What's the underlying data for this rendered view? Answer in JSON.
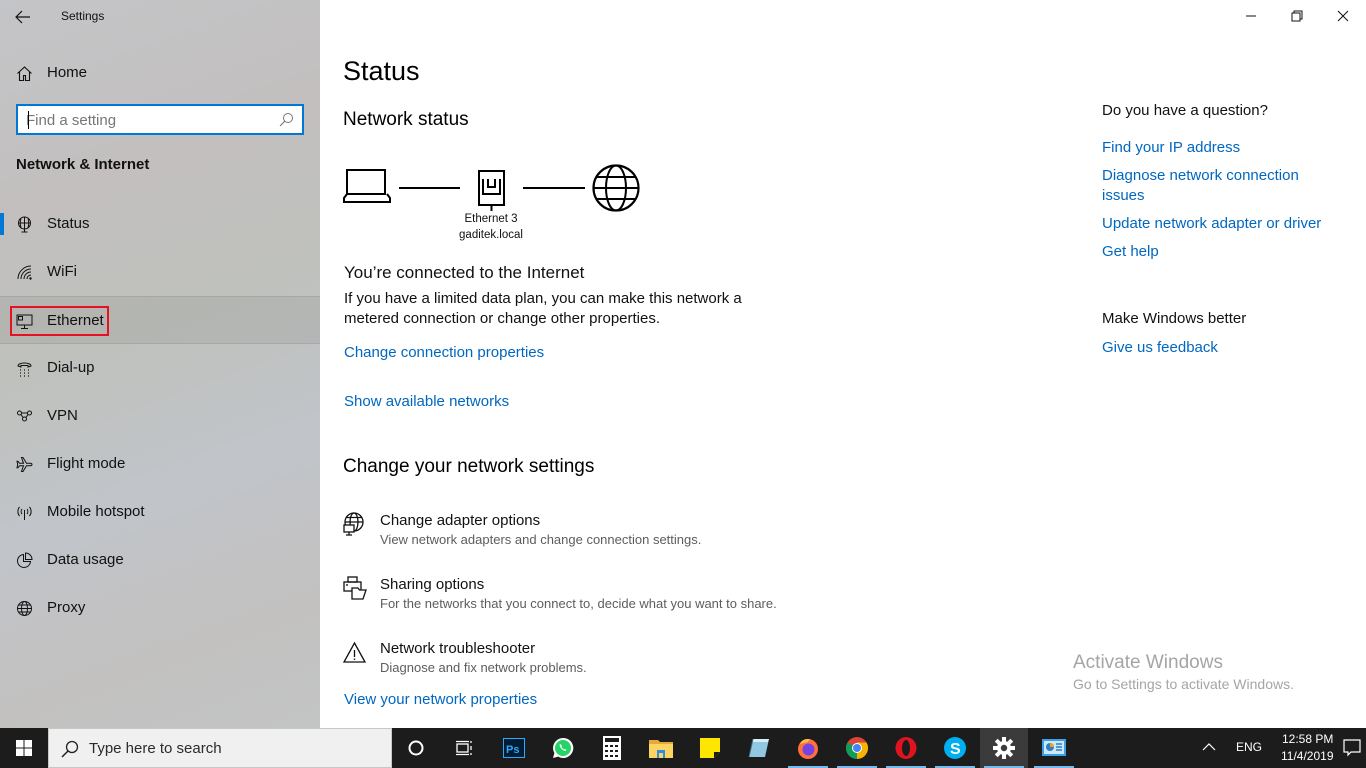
{
  "window": {
    "title": "Settings",
    "controls": {
      "minimize": "minimize-icon",
      "restore": "restore-icon",
      "close": "close-icon"
    }
  },
  "sidebar": {
    "home_label": "Home",
    "search_placeholder": "Find a setting",
    "search_value": "",
    "section_title": "Network & Internet",
    "items": [
      {
        "label": "Status",
        "icon": "network-status-icon",
        "selected": true
      },
      {
        "label": "WiFi",
        "icon": "wifi-icon"
      },
      {
        "label": "Ethernet",
        "icon": "ethernet-icon",
        "hovered": true,
        "highlighted": true
      },
      {
        "label": "Dial-up",
        "icon": "dial-up-icon"
      },
      {
        "label": "VPN",
        "icon": "vpn-icon"
      },
      {
        "label": "Flight mode",
        "icon": "airplane-icon"
      },
      {
        "label": "Mobile hotspot",
        "icon": "hotspot-icon"
      },
      {
        "label": "Data usage",
        "icon": "data-usage-icon"
      },
      {
        "label": "Proxy",
        "icon": "globe-icon"
      }
    ]
  },
  "main": {
    "page_title": "Status",
    "network_status_heading": "Network status",
    "diagram": {
      "adapter_name": "Ethernet 3",
      "network_name": "gaditek.local"
    },
    "connected_text": "You’re connected to the Internet",
    "connected_desc": "If you have a limited data plan, you can make this network a metered connection or change other properties.",
    "change_connection_link": "Change connection properties",
    "show_networks_link": "Show available networks",
    "change_settings_heading": "Change your network settings",
    "settings": [
      {
        "title": "Change adapter options",
        "subtitle": "View network adapters and change connection settings.",
        "icon": "adapter-icon"
      },
      {
        "title": "Sharing options",
        "subtitle": "For the networks that you connect to, decide what you want to share.",
        "icon": "sharing-icon"
      },
      {
        "title": "Network troubleshooter",
        "subtitle": "Diagnose and fix network problems.",
        "icon": "warning-icon"
      }
    ],
    "view_properties_link": "View your network properties"
  },
  "right_panel": {
    "question_heading": "Do you have a question?",
    "links": [
      "Find your IP address",
      "Diagnose network connection issues",
      "Update network adapter or driver",
      "Get help"
    ],
    "feedback_heading": "Make Windows better",
    "feedback_link": "Give us feedback"
  },
  "watermark": {
    "title": "Activate Windows",
    "subtitle": "Go to Settings to activate Windows."
  },
  "taskbar": {
    "search_placeholder": "Type here to search",
    "pinned": [
      "cortana-icon",
      "task-view-icon",
      "photoshop-icon",
      "whatsapp-icon",
      "calculator-icon",
      "file-explorer-icon",
      "sticky-notes-icon",
      "notepad-icon",
      "firefox-icon",
      "chrome-icon",
      "opera-icon",
      "skype-icon",
      "settings-icon",
      "control-panel-icon"
    ],
    "language": "ENG",
    "time": "12:58 PM",
    "date": "11/4/2019"
  },
  "colors": {
    "accent": "#0078d7",
    "link": "#0067c0",
    "highlight_box": "#e81123",
    "taskbar": "#1c1c1c"
  }
}
